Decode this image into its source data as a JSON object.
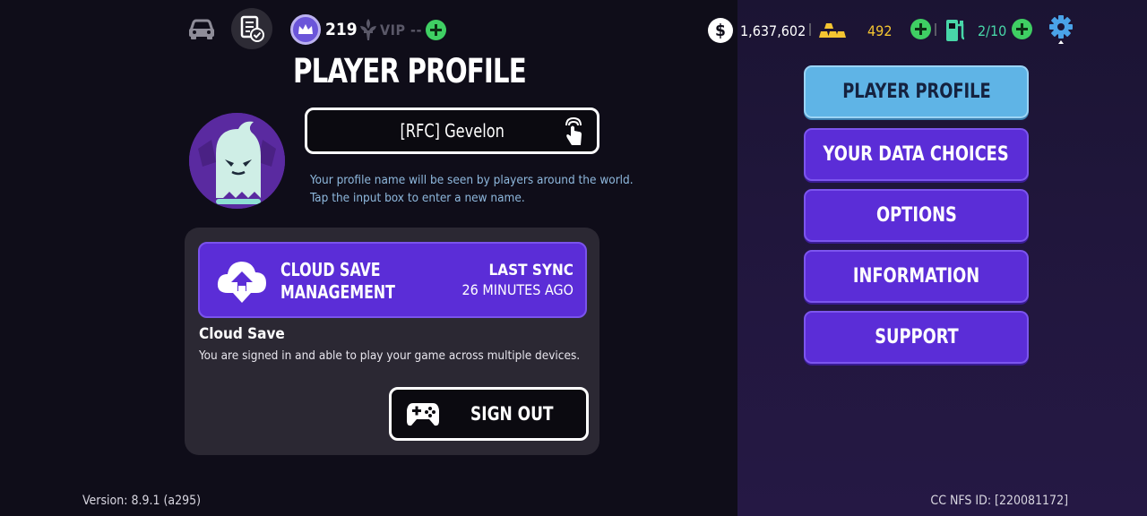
{
  "topbar": {
    "car_icon": "car-icon",
    "tasks_icon": "tasks-icon",
    "level": "219",
    "vip": "VIP --",
    "cash": "1,637,602",
    "gold": "492",
    "fuel": "2/10"
  },
  "profile": {
    "title": "PLAYER PROFILE",
    "name": "[RFC] Gevelon",
    "hint_line1": "Your profile name will be seen by players around the world.",
    "hint_line2": "Tap the input box to enter a new name."
  },
  "cloud": {
    "button_line1": "CLOUD SAVE",
    "button_line2": "MANAGEMENT",
    "sync_label": "LAST SYNC",
    "sync_time": "26 MINUTES AGO",
    "heading": "Cloud Save",
    "description": "You are signed in and able to play your game across multiple devices.",
    "signout_label": "SIGN OUT"
  },
  "menu": {
    "items": [
      {
        "label": "PLAYER PROFILE",
        "active": true
      },
      {
        "label": "YOUR DATA CHOICES",
        "active": false
      },
      {
        "label": "OPTIONS",
        "active": false
      },
      {
        "label": "INFORMATION",
        "active": false
      },
      {
        "label": "SUPPORT",
        "active": false
      }
    ]
  },
  "footer": {
    "version": "Version: 8.9.1 (a295)",
    "nfs_id": "CC NFS ID: [220081172]"
  },
  "colors": {
    "accent_purple": "#5b2dd7",
    "active_blue": "#5fb4e6",
    "gold": "#f4c531",
    "fuel": "#48d6a8",
    "plus_green": "#3fcf63"
  }
}
